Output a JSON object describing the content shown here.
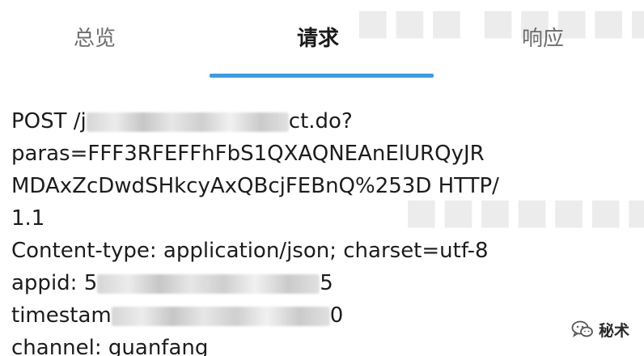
{
  "tabs": [
    {
      "label": "总览",
      "active": false
    },
    {
      "label": "请求",
      "active": true
    },
    {
      "label": "响应",
      "active": false
    }
  ],
  "accent_color": "#3d9be0",
  "request": {
    "line1": {
      "prefix": "POST /j",
      "suffix": "ct.do?"
    },
    "line2": "paras=FFF3RFEFFhFbS1QXAQNEAnElURQyJR",
    "line3": "MDAxZcDwdSHkcyAxQBcjFEBnQ%253D HTTP/",
    "line4": "1.1",
    "line5": "Content-type: application/json; charset=utf-8",
    "line6": {
      "prefix": "appid: 5",
      "suffix": "5"
    },
    "line7": {
      "prefix": "timestam",
      "suffix": "0"
    },
    "line8": "channel: guanfang"
  },
  "watermark": {
    "icon": "wechat-icon",
    "text": "秘术"
  }
}
